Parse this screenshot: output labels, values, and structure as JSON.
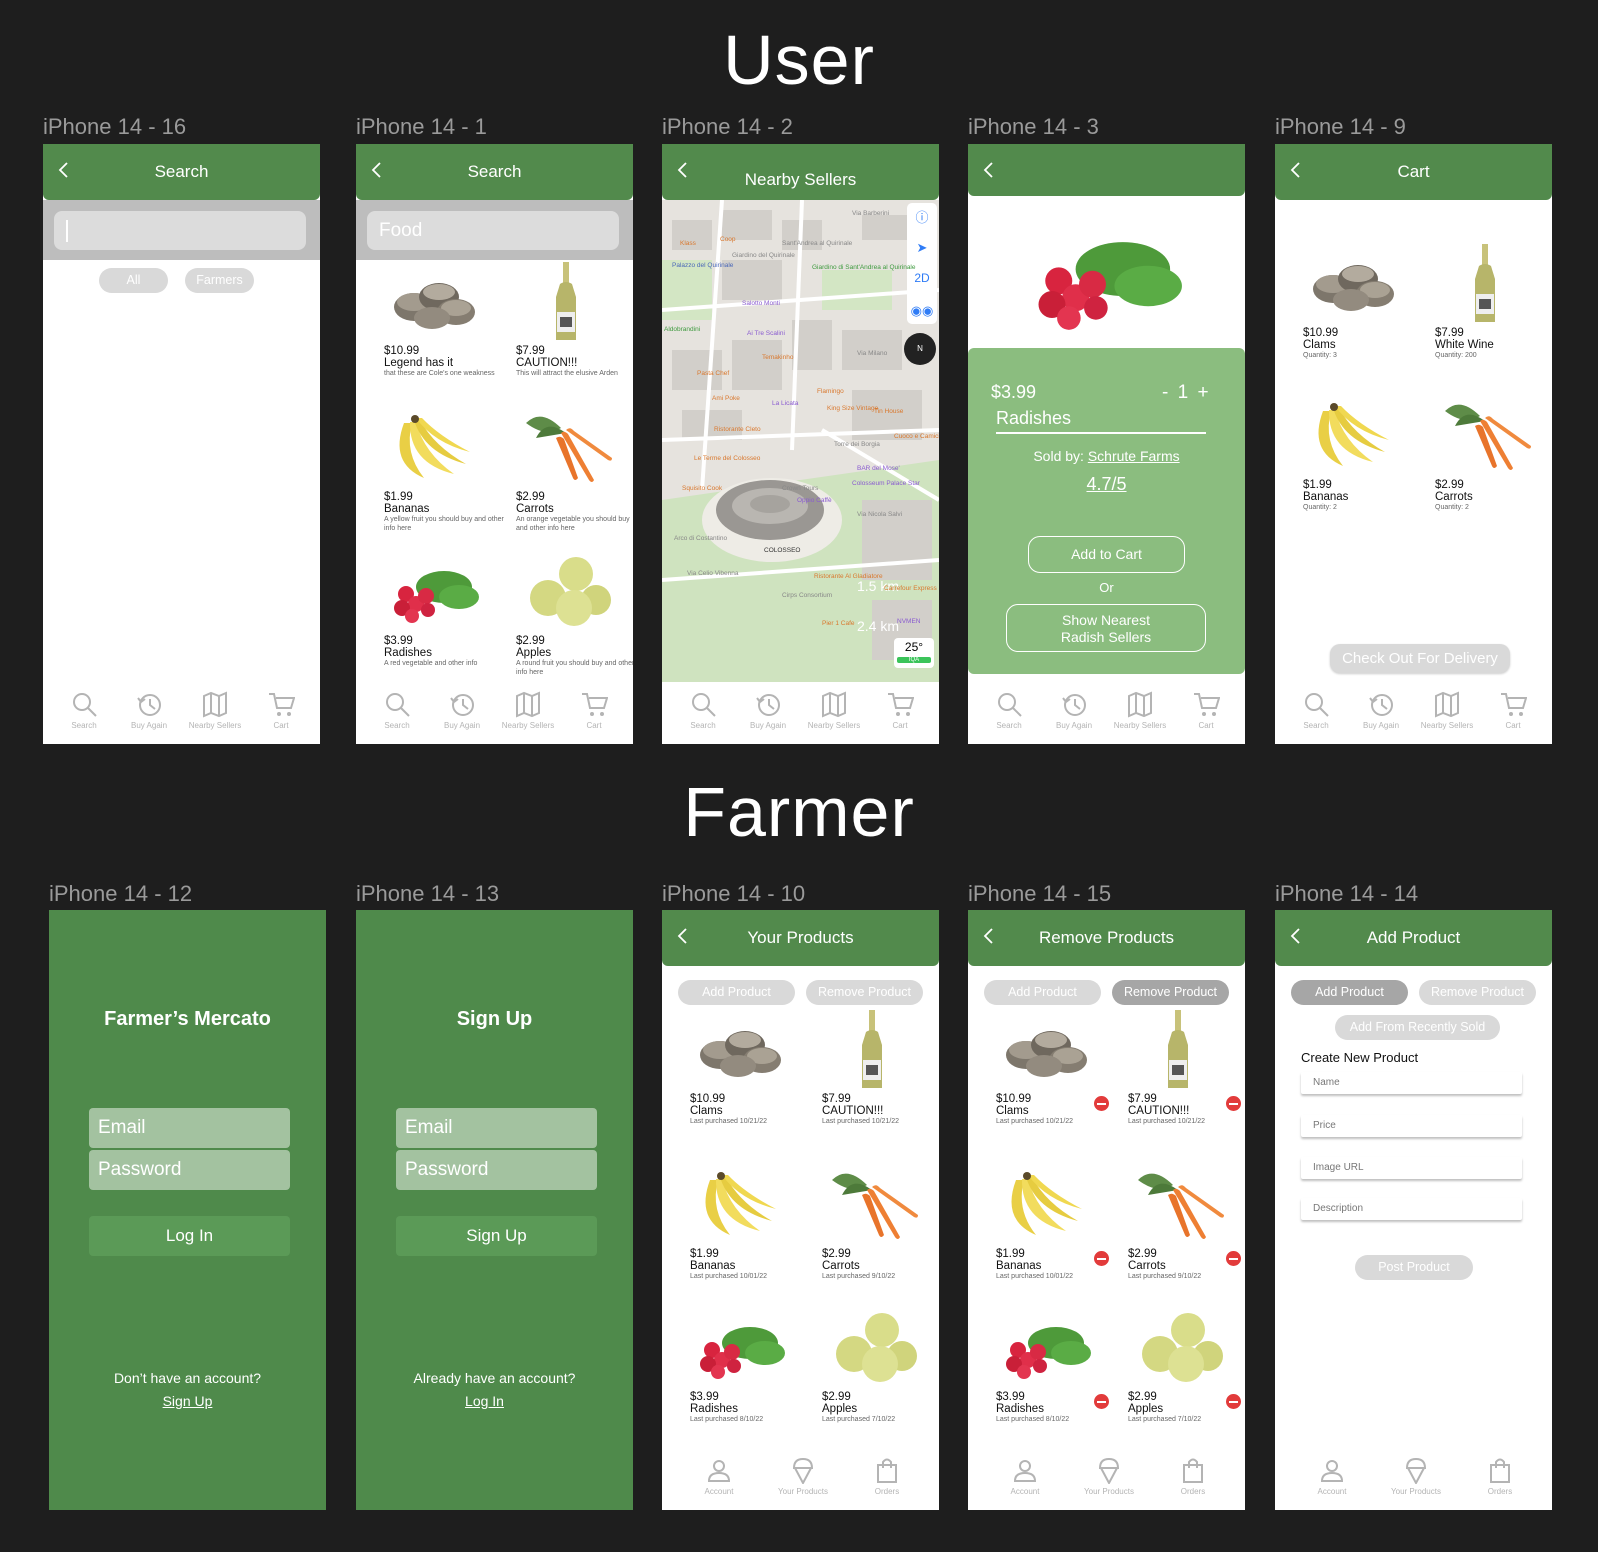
{
  "sections": {
    "user": "User",
    "farmer": "Farmer"
  },
  "user_nav": [
    {
      "label": "Search",
      "icon": "search-icon"
    },
    {
      "label": "Buy Again",
      "icon": "history-icon"
    },
    {
      "label": "Nearby Sellers",
      "icon": "map-icon"
    },
    {
      "label": "Cart",
      "icon": "cart-icon"
    }
  ],
  "farmer_nav": [
    {
      "label": "Account",
      "icon": "account-icon"
    },
    {
      "label": "Your Products",
      "icon": "ice-cream-icon"
    },
    {
      "label": "Orders",
      "icon": "bag-icon"
    }
  ],
  "colors": {
    "header": "#528a4c",
    "panel": "#8bbd7f",
    "farmer_bg": "#4f8a4b",
    "remove": "#e23b3b"
  },
  "s16": {
    "label": "iPhone 14 - 16",
    "title": "Search",
    "input_value": "",
    "chips": [
      "All",
      "Farmers"
    ]
  },
  "s1": {
    "label": "iPhone 14 - 1",
    "title": "Search",
    "input_value": "Food",
    "products": [
      {
        "price": "$10.99",
        "name": "Legend has it",
        "desc": "that these are Cole's one weakness",
        "image": "clams"
      },
      {
        "price": "$7.99",
        "name": "CAUTION!!!",
        "desc": "This will attract the elusive Arden",
        "image": "wine"
      },
      {
        "price": "$1.99",
        "name": "Bananas",
        "desc": "A yellow fruit you should buy and other info here",
        "image": "bananas"
      },
      {
        "price": "$2.99",
        "name": "Carrots",
        "desc": "An orange vegetable you should buy and other info here",
        "image": "carrots"
      },
      {
        "price": "$3.99",
        "name": "Radishes",
        "desc": "A red vegetable and other info",
        "image": "radishes"
      },
      {
        "price": "$2.99",
        "name": "Apples",
        "desc": "A round fruit you should buy and other info here",
        "image": "apples"
      }
    ]
  },
  "s2": {
    "label": "iPhone 14 - 2",
    "title": "Nearby Sellers",
    "map_controls": [
      "2D"
    ],
    "scale": [
      "1.5 km",
      "2.4 km"
    ],
    "weather": "25°",
    "aqi": "IQA",
    "map_labels": [
      "Klass",
      "Coop",
      "Palazzo del Quirinale",
      "Giardino del Quirinale",
      "Sant'Andrea al Quirinale",
      "Giardino di Sant'Andrea al Quirinale",
      "Salotto Monti",
      "Aldobrandini",
      "Ai Tre Scalini",
      "Temakinho",
      "Flamingo",
      "Pasta Chef",
      "Ami Poke",
      "La Licata",
      "King Size Vintage",
      "Tin House",
      "Ristorante Cleto",
      "Torre dei Borgia",
      "Le Terme del Colosseo",
      "BAR del Mose'",
      "Squisito Cook",
      "Crown Tours",
      "Colosseum Palace Star",
      "Oppio Caffè",
      "COLOSSEO",
      "Arco di Costantino",
      "Via Celio Vibenna",
      "Ristorante Al Gladiatore",
      "Carrefour Express",
      "Cirps Consortium",
      "Pier 1 Cafe",
      "NVMEN",
      "Via Milano",
      "Via Nicola Salvi",
      "Cuoco e Camicia",
      "Via Barberini"
    ]
  },
  "s3": {
    "label": "iPhone 14 - 3",
    "price": "$3.99",
    "quantity": "- 1 +",
    "name": "Radishes",
    "sold_by_label": "Sold by:",
    "seller": "Schrute Farms",
    "rating": "4.7/5",
    "add_to_cart": "Add to Cart",
    "or": "Or",
    "show_nearest": "Show Nearest Radish Sellers"
  },
  "s9": {
    "label": "iPhone 14 - 9",
    "title": "Cart",
    "checkout": "Check Out For Delivery",
    "products": [
      {
        "price": "$10.99",
        "name": "Clams",
        "desc": "Quantity: 3",
        "image": "clams"
      },
      {
        "price": "$7.99",
        "name": "White Wine",
        "desc": "Quantity: 200",
        "image": "wine"
      },
      {
        "price": "$1.99",
        "name": "Bananas",
        "desc": "Quantity: 2",
        "image": "bananas"
      },
      {
        "price": "$2.99",
        "name": "Carrots",
        "desc": "Quantity: 2",
        "image": "carrots"
      }
    ]
  },
  "s12": {
    "label": "iPhone 14 - 12",
    "title": "Farmer’s Mercato",
    "email": "Email",
    "password": "Password",
    "button": "Log In",
    "prompt": "Don’t have an account?",
    "link": "Sign Up"
  },
  "s13": {
    "label": "iPhone 14 - 13",
    "title": "Sign Up",
    "email": "Email",
    "password": "Password",
    "button": "Sign Up",
    "prompt": "Already have an account?",
    "link": "Log In"
  },
  "farmer_products": [
    {
      "price": "$10.99",
      "name": "Clams",
      "desc": "Last purchased 10/21/22",
      "image": "clams"
    },
    {
      "price": "$7.99",
      "name": "CAUTION!!!",
      "desc": "Last purchased 10/21/22",
      "image": "wine"
    },
    {
      "price": "$1.99",
      "name": "Bananas",
      "desc": "Last purchased 10/01/22",
      "image": "bananas"
    },
    {
      "price": "$2.99",
      "name": "Carrots",
      "desc": "Last purchased 9/10/22",
      "image": "carrots"
    },
    {
      "price": "$3.99",
      "name": "Radishes",
      "desc": "Last purchased 8/10/22",
      "image": "radishes"
    },
    {
      "price": "$2.99",
      "name": "Apples",
      "desc": "Last purchased 7/10/22",
      "image": "apples"
    }
  ],
  "s10": {
    "label": "iPhone 14 - 10",
    "title": "Your Products",
    "chips": [
      "Add Product",
      "Remove Product"
    ]
  },
  "s15": {
    "label": "iPhone 14 - 15",
    "title": "Remove Products",
    "chips": [
      "Add Product",
      "Remove Product"
    ],
    "active_chip": "Remove Product"
  },
  "s14": {
    "label": "iPhone 14 - 14",
    "title": "Add Product",
    "chips": [
      "Add Product",
      "Remove Product",
      "Add From Recently Sold"
    ],
    "active_chip": "Add Product",
    "form_title": "Create New Product",
    "fields": [
      "Name",
      "Price",
      "Image URL",
      "Description"
    ],
    "submit": "Post Product"
  }
}
